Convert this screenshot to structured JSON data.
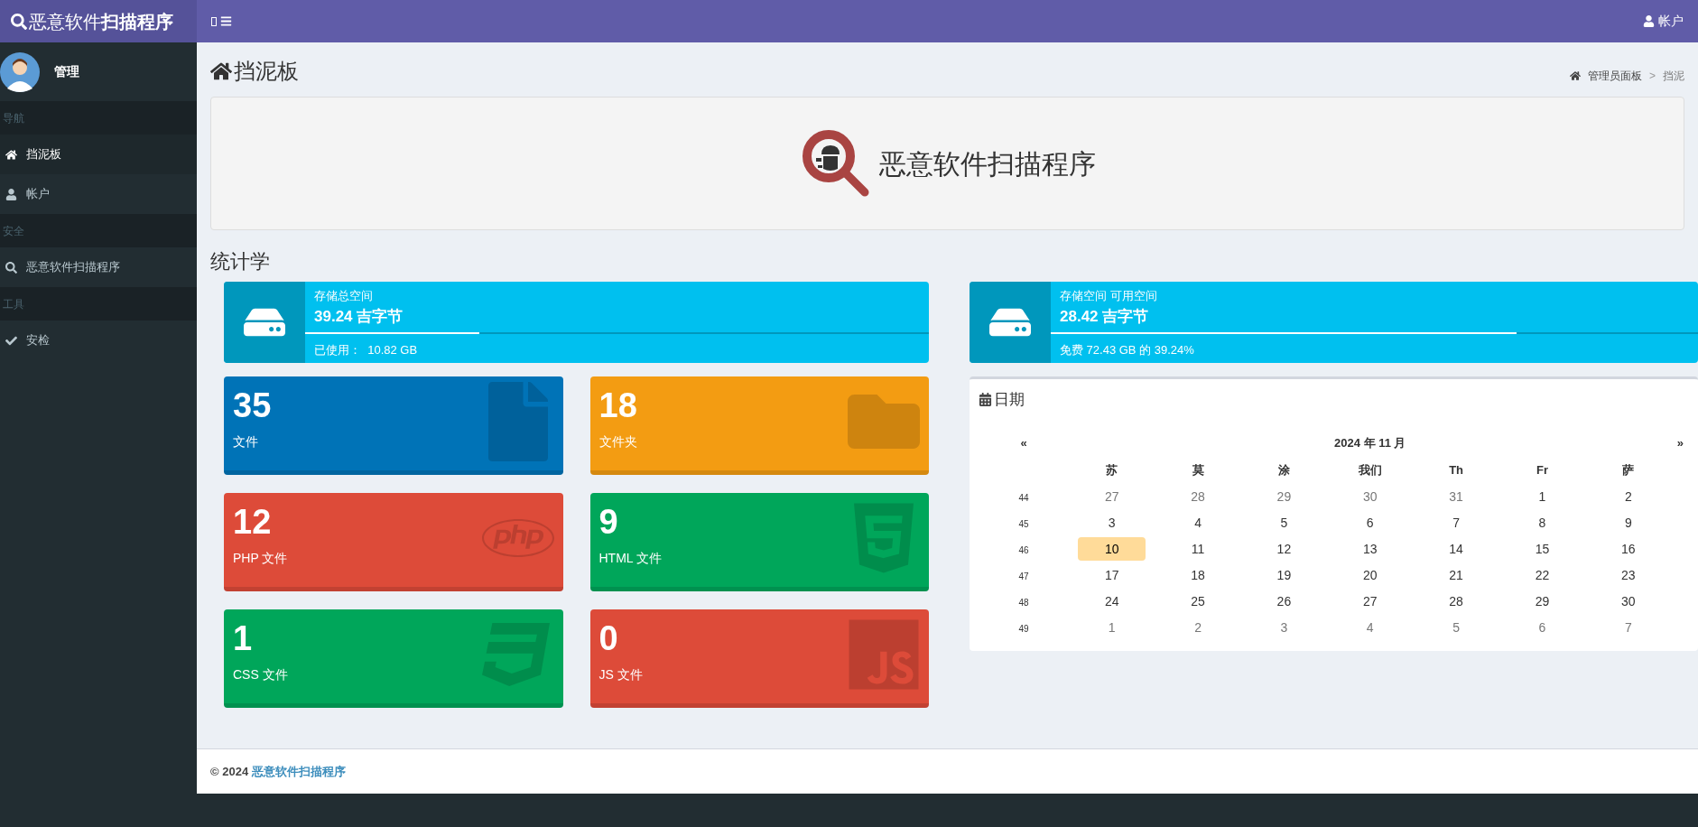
{
  "brand": {
    "light": "恶意软件",
    "bold": "扫描程序"
  },
  "top_nav": {
    "account": "帐户"
  },
  "user_panel": {
    "name": "管理"
  },
  "sidebar": [
    {
      "kind": "header",
      "label": "导航"
    },
    {
      "kind": "item",
      "label": "挡泥板",
      "selected": true
    },
    {
      "kind": "item",
      "label": "帐户",
      "selected": false
    },
    {
      "kind": "header",
      "label": "安全"
    },
    {
      "kind": "item",
      "label": "恶意软件扫描程序",
      "selected": false
    },
    {
      "kind": "header",
      "label": "工具"
    },
    {
      "kind": "item",
      "label": "安检",
      "selected": false
    }
  ],
  "page_title": "挡泥板",
  "breadcrumb": {
    "separator": ">",
    "items": [
      {
        "label": "管理员面板"
      },
      {
        "label": "挡泥"
      }
    ]
  },
  "banner": {
    "title": "恶意软件扫描程序"
  },
  "stats_title": "统计学",
  "storage": [
    {
      "label": "存储总空间",
      "value": "39.24 吉字节",
      "level": 0.28,
      "note": "已使用：  10.82 GB"
    },
    {
      "label": "存储空间 可用空间",
      "value": "28.42 吉字节",
      "level": 0.72,
      "note": "免费 72.43 GB 的 39.24%"
    }
  ],
  "counters": [
    {
      "count": "35",
      "label": "文件",
      "color": "#0073b7"
    },
    {
      "count": "18",
      "label": "文件夹",
      "color": "#f39c12"
    },
    {
      "count": "12",
      "label": "PHP 文件",
      "color": "#dd4b39"
    },
    {
      "count": "9",
      "label": "HTML 文件",
      "color": "#00a65a"
    },
    {
      "count": "1",
      "label": "CSS 文件",
      "color": "#00a65a"
    },
    {
      "count": "0",
      "label": "JS 文件",
      "color": "#dd4b39"
    }
  ],
  "calendar": {
    "title": "日期",
    "prev": "«",
    "next": "»",
    "month": "2024 年 11 月",
    "weekdays": [
      "苏",
      "莫",
      "涂",
      "我们",
      "Th",
      "Fr",
      "萨"
    ],
    "weeks": [
      {
        "number": "44",
        "days": [
          {
            "day": "27",
            "muted": true,
            "selected": false
          },
          {
            "day": "28",
            "muted": true,
            "selected": false
          },
          {
            "day": "29",
            "muted": true,
            "selected": false
          },
          {
            "day": "30",
            "muted": true,
            "selected": false
          },
          {
            "day": "31",
            "muted": true,
            "selected": false
          },
          {
            "day": "1",
            "muted": false,
            "selected": false
          },
          {
            "day": "2",
            "muted": false,
            "selected": false
          }
        ]
      },
      {
        "number": "45",
        "days": [
          {
            "day": "3",
            "muted": false,
            "selected": false
          },
          {
            "day": "4",
            "muted": false,
            "selected": false
          },
          {
            "day": "5",
            "muted": false,
            "selected": false
          },
          {
            "day": "6",
            "muted": false,
            "selected": false
          },
          {
            "day": "7",
            "muted": false,
            "selected": false
          },
          {
            "day": "8",
            "muted": false,
            "selected": false
          },
          {
            "day": "9",
            "muted": false,
            "selected": false
          }
        ]
      },
      {
        "number": "46",
        "days": [
          {
            "day": "10",
            "muted": false,
            "selected": true
          },
          {
            "day": "11",
            "muted": false,
            "selected": false
          },
          {
            "day": "12",
            "muted": false,
            "selected": false
          },
          {
            "day": "13",
            "muted": false,
            "selected": false
          },
          {
            "day": "14",
            "muted": false,
            "selected": false
          },
          {
            "day": "15",
            "muted": false,
            "selected": false
          },
          {
            "day": "16",
            "muted": false,
            "selected": false
          }
        ]
      },
      {
        "number": "47",
        "days": [
          {
            "day": "17",
            "muted": false,
            "selected": false
          },
          {
            "day": "18",
            "muted": false,
            "selected": false
          },
          {
            "day": "19",
            "muted": false,
            "selected": false
          },
          {
            "day": "20",
            "muted": false,
            "selected": false
          },
          {
            "day": "21",
            "muted": false,
            "selected": false
          },
          {
            "day": "22",
            "muted": false,
            "selected": false
          },
          {
            "day": "23",
            "muted": false,
            "selected": false
          }
        ]
      },
      {
        "number": "48",
        "days": [
          {
            "day": "24",
            "muted": false,
            "selected": false
          },
          {
            "day": "25",
            "muted": false,
            "selected": false
          },
          {
            "day": "26",
            "muted": false,
            "selected": false
          },
          {
            "day": "27",
            "muted": false,
            "selected": false
          },
          {
            "day": "28",
            "muted": false,
            "selected": false
          },
          {
            "day": "29",
            "muted": false,
            "selected": false
          },
          {
            "day": "30",
            "muted": false,
            "selected": false
          }
        ]
      },
      {
        "number": "49",
        "days": [
          {
            "day": "1",
            "muted": true,
            "selected": false
          },
          {
            "day": "2",
            "muted": true,
            "selected": false
          },
          {
            "day": "3",
            "muted": true,
            "selected": false
          },
          {
            "day": "4",
            "muted": true,
            "selected": false
          },
          {
            "day": "5",
            "muted": true,
            "selected": false
          },
          {
            "day": "6",
            "muted": true,
            "selected": false
          },
          {
            "day": "7",
            "muted": true,
            "selected": false
          }
        ]
      }
    ]
  },
  "footer": {
    "copyright": "© 2024",
    "link": "恶意软件扫描程序"
  }
}
